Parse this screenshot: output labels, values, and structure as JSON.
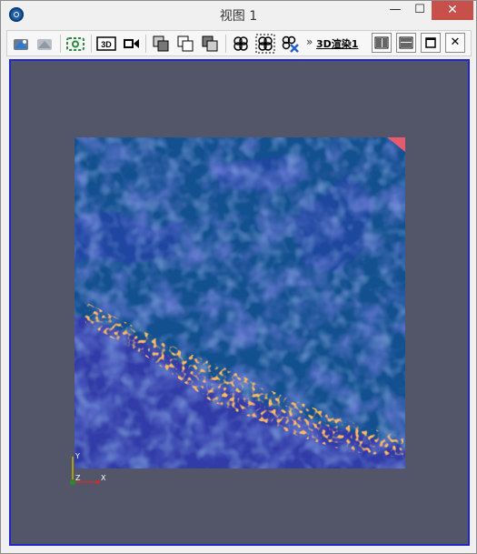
{
  "window": {
    "title": "视图 1",
    "minimize_glyph": "—",
    "maximize_glyph": "☐",
    "close_glyph": "✕"
  },
  "toolbar": {
    "icons": [
      "reset-camera-icon",
      "previous-camera-icon",
      "screenshot-icon",
      "3d-icon",
      "record-video-icon",
      "layer-copy-icon",
      "layer-paste-icon",
      "layer-stack-icon",
      "link-views-icon",
      "select-views-icon",
      "unlink-views-icon",
      "split-horizontal-icon",
      "split-vertical-icon",
      "maximize-view-icon",
      "close-view-icon"
    ],
    "overflow": "»",
    "render_label": "3D渲染1",
    "icon_3d_text": "3D",
    "close_view_glyph": "✕"
  },
  "axes": {
    "y": "Y",
    "z": "Z",
    "x": "X"
  },
  "colors": {
    "background": "#535569",
    "terrain_blue": "#13508f",
    "terrain_violet": "#3e36b0",
    "hot_orange": "#ff7a1f",
    "frame_border": "#2028c8"
  }
}
